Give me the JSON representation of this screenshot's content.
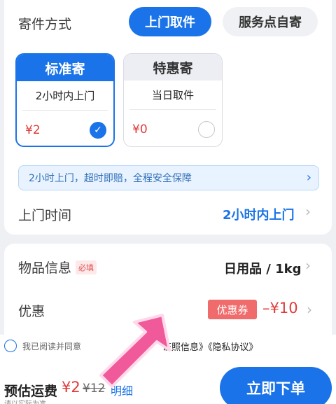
{
  "send_method": {
    "label": "寄件方式",
    "options": [
      "上门取件",
      "服务点自寄"
    ],
    "selected": "上门取件"
  },
  "service_types": [
    {
      "title": "标准寄",
      "subtitle": "2小时内上门",
      "price": "¥2",
      "selected": true
    },
    {
      "title": "特惠寄",
      "subtitle": "当日取件",
      "price": "¥0",
      "selected": false
    }
  ],
  "banner": {
    "text": "2小时上门，超时即赔，全程安全保障"
  },
  "pickup_time": {
    "label": "上门时间",
    "value": "2小时内上门"
  },
  "item_info": {
    "label": "物品信息",
    "required_tag": "必填",
    "value": "日用品 / 1kg"
  },
  "discount": {
    "label": "优惠",
    "coupon_tag": "优惠券",
    "amount": "–¥10"
  },
  "agreement": {
    "prefix": "我已阅读并同意",
    "links": "证照信息》《隐私协议》"
  },
  "footer": {
    "estimate_label": "预估运费",
    "estimate_price": "¥2",
    "original_price": "¥12",
    "detail_link": "明细",
    "subtext": "请以实际为准",
    "submit_label": "立即下单"
  },
  "colors": {
    "accent": "#1a73e8",
    "price_red": "#e03a3a",
    "overlay_arrow": "#f05a9a"
  }
}
